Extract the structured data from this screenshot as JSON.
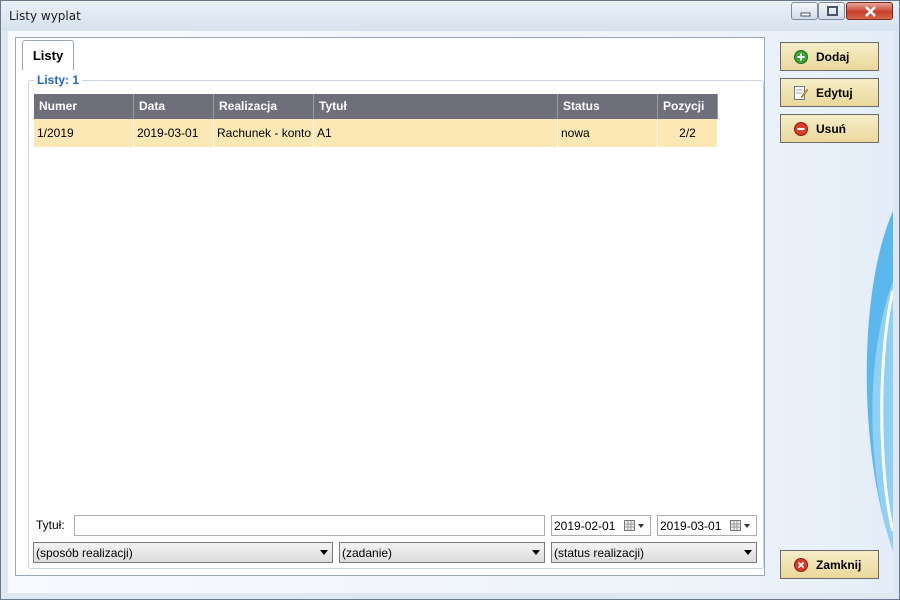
{
  "window": {
    "title": "Listy wyplat"
  },
  "tabs": [
    {
      "label": "Listy"
    }
  ],
  "group": {
    "label": "Listy: 1"
  },
  "grid": {
    "columns": [
      "Numer",
      "Data",
      "Realizacja",
      "Tytuł",
      "Status",
      "Pozycji"
    ],
    "rows": [
      [
        "1/2019",
        "2019-03-01",
        "Rachunek - konto",
        "A1",
        "nowa",
        "2/2"
      ]
    ],
    "row_color": "#fbe8b4",
    "header_color": "#6f6f7b"
  },
  "filters": {
    "title_label": "Tytuł:",
    "title_value": "",
    "date_from": "2019-02-01",
    "date_to": "2019-03-01",
    "payment_method": "(sposób realizacji)",
    "task": "(zadanie)",
    "status": "(status realizacji)"
  },
  "buttons": {
    "add": "Dodaj",
    "edit": "Edytuj",
    "delete": "Usuń",
    "close": "Zamknij"
  },
  "icons": {
    "add": "plus-circle-icon",
    "edit": "edit-document-icon",
    "delete": "minus-circle-icon",
    "close": "close-circle-icon",
    "calendar": "calendar-icon"
  }
}
